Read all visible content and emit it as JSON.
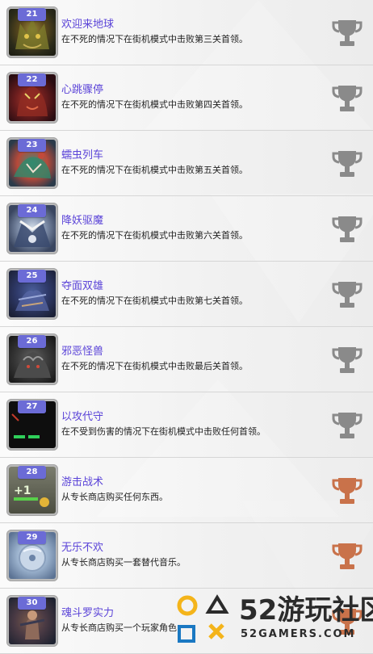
{
  "achievements": [
    {
      "number": "21",
      "title": "欢迎来地球",
      "description": "在不死的情况下在街机模式中击败第三关首领。",
      "trophy": "silver"
    },
    {
      "number": "22",
      "title": "心跳骤停",
      "description": "在不死的情况下在街机模式中击败第四关首领。",
      "trophy": "silver"
    },
    {
      "number": "23",
      "title": "蠕虫列车",
      "description": "在不死的情况下在街机模式中击败第五关首领。",
      "trophy": "silver"
    },
    {
      "number": "24",
      "title": "降妖驱魔",
      "description": "在不死的情况下在街机模式中击败第六关首领。",
      "trophy": "silver"
    },
    {
      "number": "25",
      "title": "夺面双雄",
      "description": "在不死的情况下在街机模式中击败第七关首领。",
      "trophy": "silver"
    },
    {
      "number": "26",
      "title": "邪恶怪兽",
      "description": "在不死的情况下在街机模式中击败最后关首领。",
      "trophy": "silver"
    },
    {
      "number": "27",
      "title": "以攻代守",
      "description": "在不受到伤害的情况下在街机模式中击败任何首领。",
      "trophy": "silver"
    },
    {
      "number": "28",
      "title": "游击战术",
      "description": "从专长商店购买任何东西。",
      "trophy": "bronze"
    },
    {
      "number": "29",
      "title": "无乐不欢",
      "description": "从专长商店购买一套替代音乐。",
      "trophy": "bronze"
    },
    {
      "number": "30",
      "title": "魂斗罗实力",
      "description": "从专长商店购买一个玩家角色",
      "trophy": "bronze"
    }
  ],
  "thumb_28_label": "+1",
  "watermark": {
    "big_text": "52游玩社区",
    "small_text": "52GAMERS.COM"
  },
  "colors": {
    "title": "#5b44d8",
    "badge": "#6b6bd6",
    "silver_trophy": "#8a8a8a",
    "bronze_trophy": "#c9724a"
  },
  "icons": [
    "trophy-icon",
    "playstation-shapes-icon"
  ]
}
